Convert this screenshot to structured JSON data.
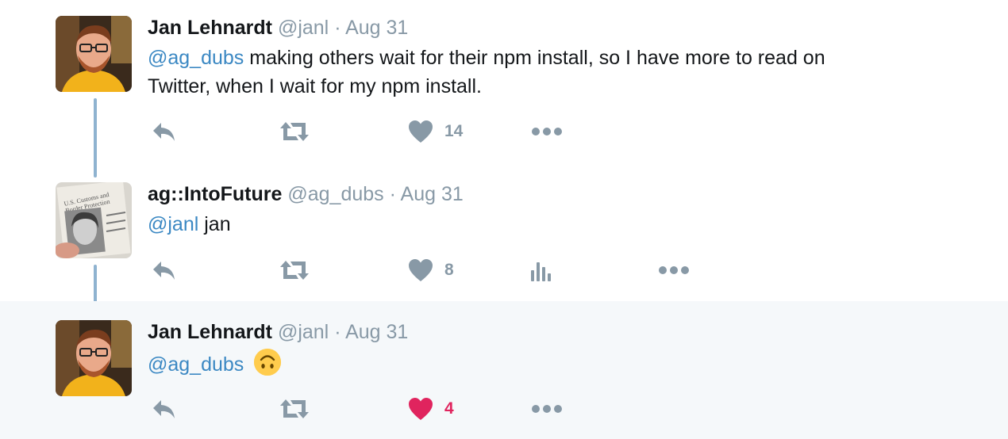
{
  "tweets": [
    {
      "name": "Jan Lehnardt",
      "handle": "@janl",
      "separator": "·",
      "date": "Aug 31",
      "mention": "@ag_dubs",
      "text_line1": " making others wait for their npm install, so I have more to read on",
      "text_line2": "Twitter, when I wait for my npm install.",
      "like_count": "14",
      "liked": false
    },
    {
      "name": "ag::IntoFuture",
      "handle": "@ag_dubs",
      "separator": "·",
      "date": "Aug 31",
      "mention": "@janl",
      "text": " jan",
      "avatar_text_line1": "U.S. Customs and",
      "avatar_text_line2": "Border Protection",
      "like_count": "8",
      "liked": false
    },
    {
      "name": "Jan Lehnardt",
      "handle": "@janl",
      "separator": "·",
      "date": "Aug 31",
      "mention": "@ag_dubs",
      "emoji": "upside-down-face",
      "like_count": "4",
      "liked": true
    }
  ],
  "colors": {
    "mention": "#3b88c3",
    "muted": "#8899a6",
    "like_active": "#e0245e",
    "thread_line": "#8fb3d0",
    "highlight_bg": "#f5f8fa"
  },
  "icons": [
    "reply-icon",
    "retweet-icon",
    "heart-icon",
    "analytics-icon",
    "more-icon"
  ]
}
